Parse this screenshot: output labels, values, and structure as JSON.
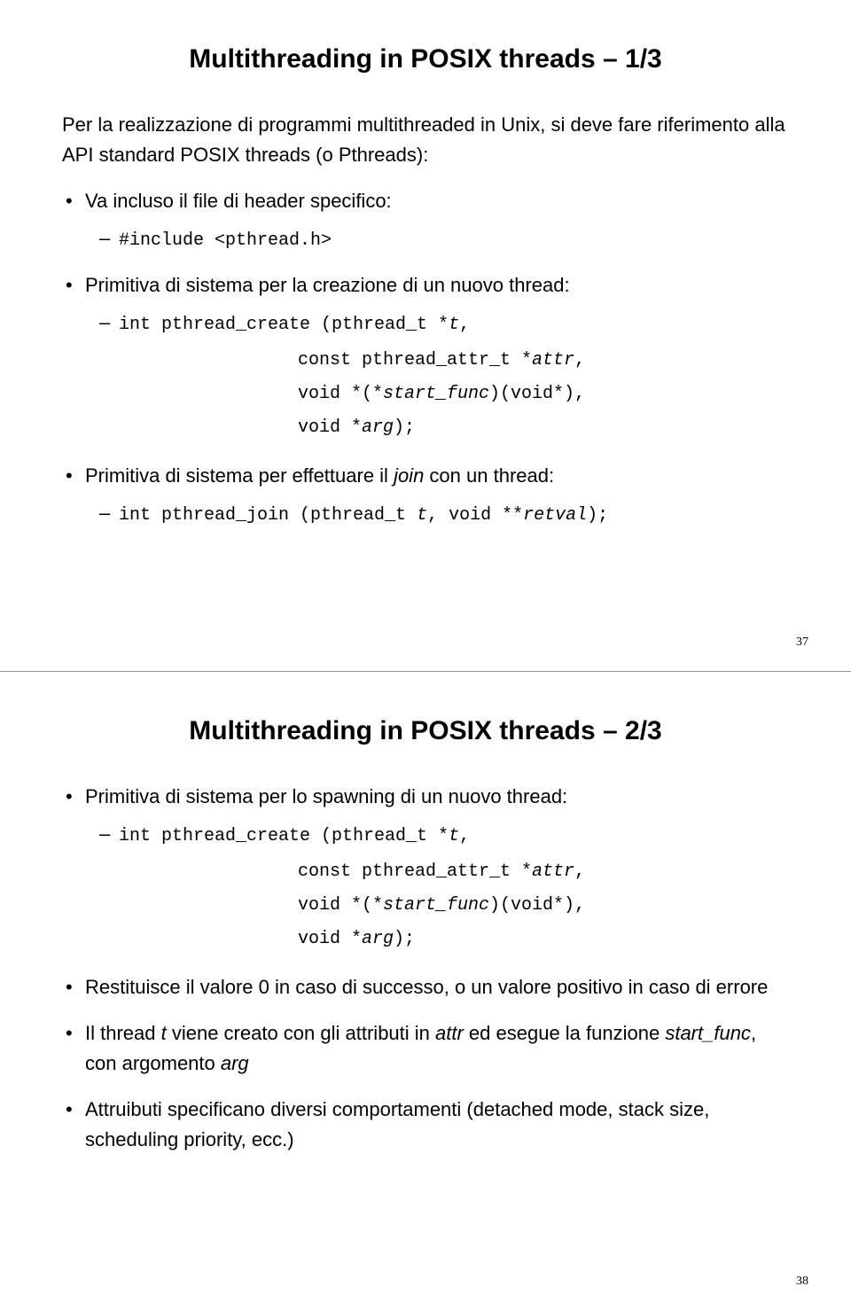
{
  "slide1": {
    "title": "Multithreading in POSIX threads – 1/3",
    "intro": "Per la realizzazione di programmi multithreaded in Unix, si deve fare riferimento alla API standard POSIX threads (o Pthreads):",
    "b1": "Va incluso il file di header specifico:",
    "b1_code": "#include <pthread.h>",
    "b2": "Primitiva di sistema per la creazione di un nuovo thread:",
    "b2_code_a": "int pthread_create (pthread_t *",
    "b2_code_a_it": "t",
    "b2_code_a_end": ",",
    "b2_code_l1a": "const pthread_attr_t *",
    "b2_code_l1b": "attr",
    "b2_code_l1c": ",",
    "b2_code_l2a": "void *(*",
    "b2_code_l2b": "start_func",
    "b2_code_l2c": ")(void*),",
    "b2_code_l3a": "void *",
    "b2_code_l3b": "arg",
    "b2_code_l3c": ");",
    "b3a": "Primitiva di sistema per effettuare il ",
    "b3b": "join",
    "b3c": " con un thread:",
    "b3_code_a": "int pthread_join (pthread_t ",
    "b3_code_b": "t",
    "b3_code_c": ", void **",
    "b3_code_d": "retval",
    "b3_code_e": ");",
    "pagenum": "37"
  },
  "slide2": {
    "title": "Multithreading in POSIX threads – 2/3",
    "b1": "Primitiva di sistema per lo spawning di un nuovo thread:",
    "b1_code_a": "int pthread_create (pthread_t *",
    "b1_code_a_it": "t",
    "b1_code_a_end": ",",
    "b1_code_l1a": "const pthread_attr_t *",
    "b1_code_l1b": "attr",
    "b1_code_l1c": ",",
    "b1_code_l2a": "void *(*",
    "b1_code_l2b": "start_func",
    "b1_code_l2c": ")(void*),",
    "b1_code_l3a": "void *",
    "b1_code_l3b": "arg",
    "b1_code_l3c": ");",
    "b2": "Restituisce il valore 0 in caso di successo, o un valore positivo in caso di errore",
    "b3a": "Il thread ",
    "b3b": "t",
    "b3c": " viene creato con gli attributi in ",
    "b3d": "attr",
    "b3e": " ed esegue la funzione ",
    "b3f": "start_func",
    "b3g": ", con argomento ",
    "b3h": "arg",
    "b4": "Attruibuti specificano diversi comportamenti (detached mode, stack size, scheduling priority, ecc.)",
    "pagenum": "38"
  }
}
